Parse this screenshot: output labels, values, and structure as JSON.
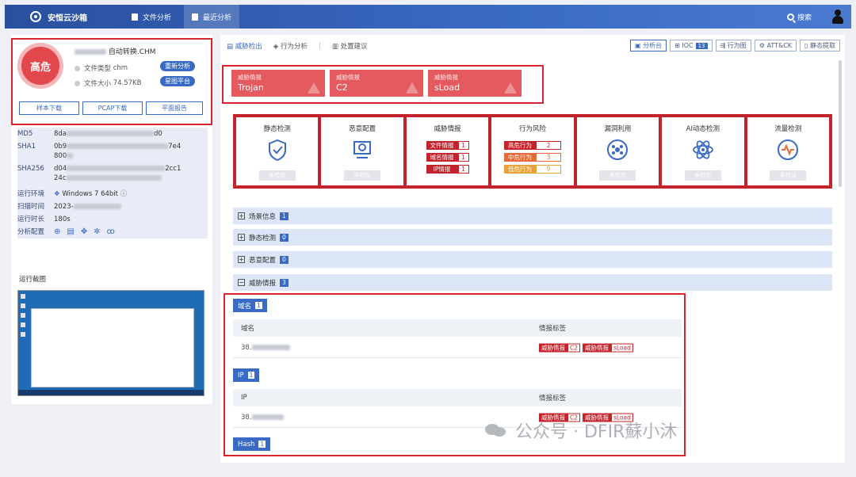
{
  "topbar": {
    "app_name": "安恒云沙箱",
    "tabs": [
      {
        "label": "文件分析"
      },
      {
        "label": "最近分析"
      }
    ],
    "search_label": "搜索"
  },
  "summary": {
    "risk_level": "高危",
    "file_name_suffix": "自动转换.CHM",
    "file_type_label": "文件类型",
    "file_type": "chm",
    "file_size_label": "文件大小",
    "file_size": "74.57KB",
    "reanalyze_label": "重新分析",
    "xingtu_label": "星图平台",
    "buttons": [
      "样本下载",
      "PCAP下载",
      "平面报告"
    ]
  },
  "details": {
    "md5_label": "MD5",
    "md5_prefix": "8da",
    "md5_suffix": "d0",
    "sha1_label": "SHA1",
    "sha1_prefix": "0b9",
    "sha1_suffix": "7e4",
    "sha1_line2": "800",
    "sha256_label": "SHA256",
    "sha256_prefix": "d04",
    "sha256_suffix": "2cc1",
    "sha256_line2": "24c",
    "env_label": "运行环境",
    "env_value": "Windows 7 64bit",
    "scan_time_label": "扫描时间",
    "scan_time_value": "2023-",
    "duration_label": "运行时长",
    "duration_value": "180s",
    "config_label": "分析配置"
  },
  "screenshot_title": "运行截图",
  "main": {
    "subtabs": [
      "威胁检出",
      "行为分析",
      "处置建议"
    ],
    "tools": [
      {
        "label": "分析台"
      },
      {
        "label": "IOC",
        "count": "13"
      },
      {
        "label": "行为图"
      },
      {
        "label": "ATT&CK"
      },
      {
        "label": "静态提取"
      }
    ],
    "intel_cards": [
      {
        "title": "威胁情报",
        "value": "Trojan"
      },
      {
        "title": "威胁情报",
        "value": "C2"
      },
      {
        "title": "威胁情报",
        "value": "sLoad"
      }
    ],
    "detect_cards": [
      {
        "title": "静态检测",
        "status": "未检出",
        "icon": "shield-check-icon"
      },
      {
        "title": "恶意配置",
        "status": "未检出",
        "icon": "gear-monitor-icon"
      },
      {
        "title": "威胁情报",
        "rows": [
          {
            "label": "文件情报",
            "count": "1"
          },
          {
            "label": "域名情报",
            "count": "1"
          },
          {
            "label": "IP情报",
            "count": "1"
          }
        ]
      },
      {
        "title": "行为风险",
        "rows": [
          {
            "label": "高危行为",
            "count": "2"
          },
          {
            "label": "中危行为",
            "count": "3"
          },
          {
            "label": "低危行为",
            "count": "9"
          }
        ]
      },
      {
        "title": "漏洞利用",
        "status": "未检出",
        "icon": "bug-circle-icon"
      },
      {
        "title": "AI动态检测",
        "status": "未检出",
        "icon": "atom-icon"
      },
      {
        "title": "流量检测",
        "status": "未检出",
        "icon": "pulse-circle-icon"
      }
    ],
    "sections": [
      {
        "label": "场景信息",
        "count": "1",
        "expanded": false
      },
      {
        "label": "静态检测",
        "count": "0",
        "expanded": false
      },
      {
        "label": "恶意配置",
        "count": "0",
        "expanded": false
      },
      {
        "label": "威胁情报",
        "count": "3",
        "expanded": true
      }
    ],
    "domain_table": {
      "label": "域名",
      "count": "1",
      "col1": "域名",
      "col2": "情报标签",
      "row_value": "38.",
      "tags": [
        {
          "a": "威胁情报",
          "b": "C2"
        },
        {
          "a": "威胁情报",
          "b": "sLoad"
        }
      ]
    },
    "ip_table": {
      "label": "IP",
      "count": "1",
      "col1": "IP",
      "col2": "情报标签",
      "row_value": "38.",
      "tags": [
        {
          "a": "威胁情报",
          "b": "C2"
        },
        {
          "a": "威胁情报",
          "b": "sLoad"
        }
      ]
    },
    "hash_label": "Hash",
    "hash_count": "1"
  },
  "watermark": "公众号 · DFIR蘇小沐"
}
